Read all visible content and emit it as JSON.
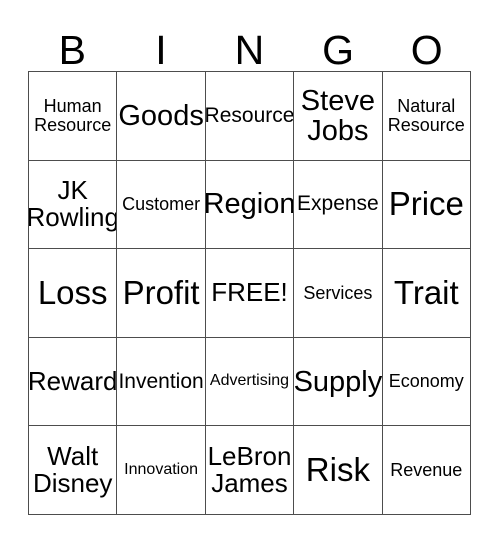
{
  "card": {
    "type": "bingo-card",
    "columns": 5,
    "rows": 5,
    "header": {
      "letters": [
        "B",
        "I",
        "N",
        "G",
        "O"
      ]
    },
    "colors": {
      "background": "#ffffff",
      "cell_background": "#ffffff",
      "border": "#4d4d4d",
      "text": "#000000"
    },
    "free_space": {
      "label": "FREE!",
      "row": 3,
      "column": 3
    },
    "cells": [
      {
        "text": "Human\nResource",
        "size": "fs-xs"
      },
      {
        "text": "Goods",
        "size": "fs-lg"
      },
      {
        "text": "Resource",
        "size": "fs-sm"
      },
      {
        "text": "Steve\nJobs",
        "size": "fs-lg"
      },
      {
        "text": "Natural\nResource",
        "size": "fs-xs"
      },
      {
        "text": "JK\nRowling",
        "size": "fs-md"
      },
      {
        "text": "Customer",
        "size": "fs-xs"
      },
      {
        "text": "Region",
        "size": "fs-lg"
      },
      {
        "text": "Expense",
        "size": "fs-sm"
      },
      {
        "text": "Price",
        "size": "fs-xl"
      },
      {
        "text": "Loss",
        "size": "fs-xl"
      },
      {
        "text": "Profit",
        "size": "fs-xl"
      },
      {
        "text": "FREE!",
        "size": "fs-md"
      },
      {
        "text": "Services",
        "size": "fs-xs"
      },
      {
        "text": "Trait",
        "size": "fs-xl"
      },
      {
        "text": "Reward",
        "size": "fs-md"
      },
      {
        "text": "Invention",
        "size": "fs-sm"
      },
      {
        "text": "Advertising",
        "size": "fs-xxs"
      },
      {
        "text": "Supply",
        "size": "fs-lg"
      },
      {
        "text": "Economy",
        "size": "fs-xs"
      },
      {
        "text": "Walt\nDisney",
        "size": "fs-md"
      },
      {
        "text": "Innovation",
        "size": "fs-xxs"
      },
      {
        "text": "LeBron\nJames",
        "size": "fs-md"
      },
      {
        "text": "Risk",
        "size": "fs-xl"
      },
      {
        "text": "Revenue",
        "size": "fs-xs"
      }
    ]
  }
}
